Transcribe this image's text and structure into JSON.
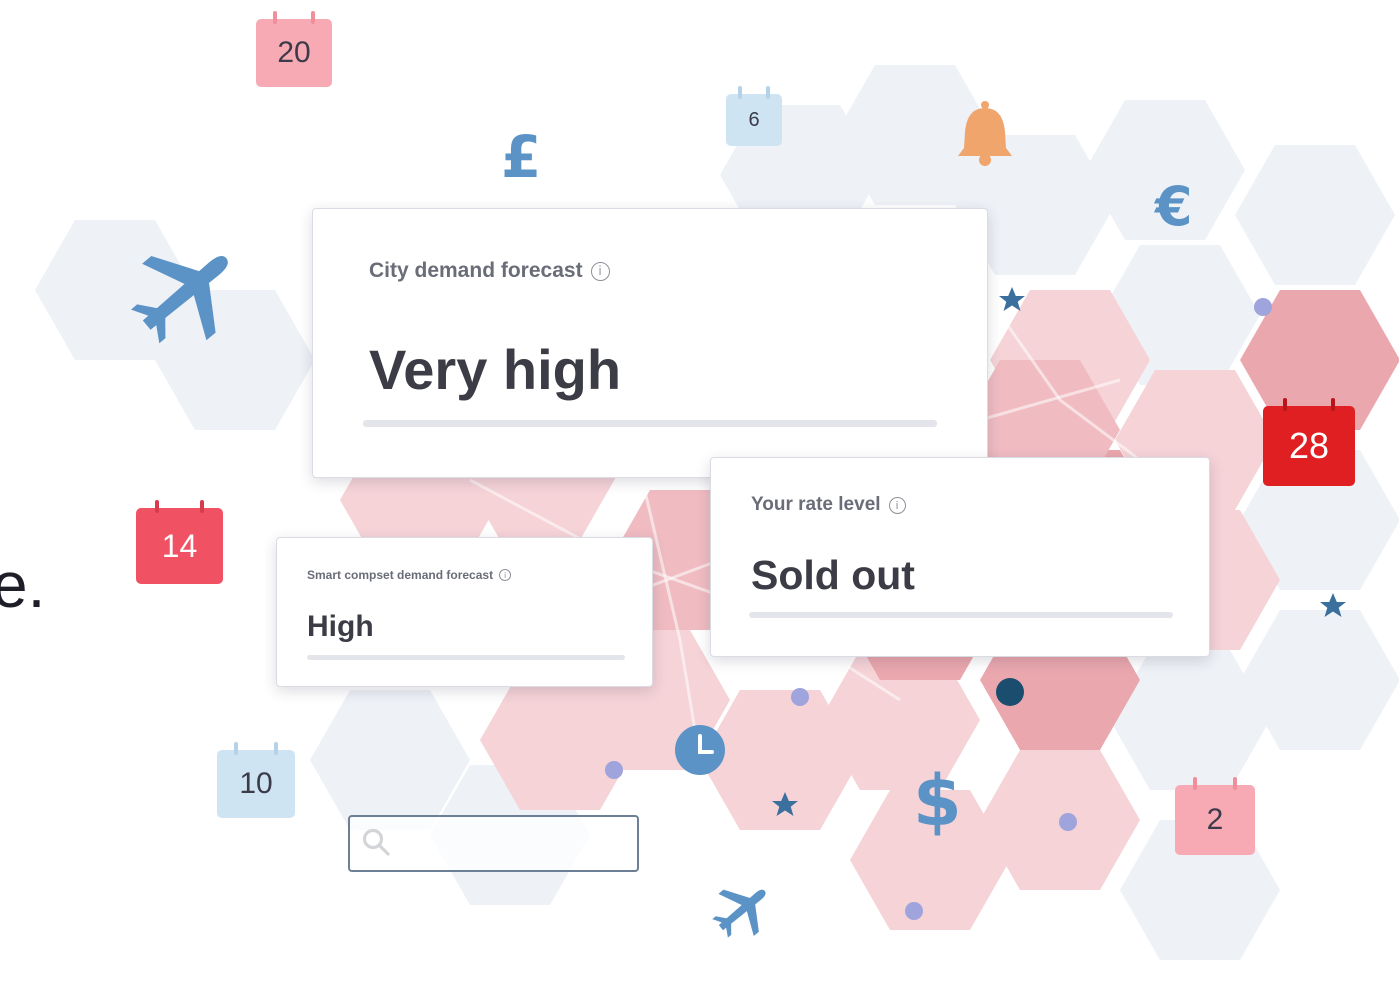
{
  "cards": {
    "city_demand": {
      "label": "City demand forecast",
      "value": "Very high"
    },
    "rate_level": {
      "label": "Your rate level",
      "value": "Sold out"
    },
    "compset_demand": {
      "label": "Smart compset demand forecast",
      "value": "High"
    }
  },
  "calendar_dates": {
    "top_left": "20",
    "top_middle": "6",
    "left": "14",
    "bottom_left": "10",
    "right": "28",
    "bottom_right": "2"
  },
  "currency_symbols": {
    "pound": "£",
    "euro": "€",
    "dollar": "$"
  },
  "edge_text": "e.",
  "search": {
    "placeholder": ""
  },
  "colors": {
    "hex_light": "#eef1f6",
    "hex_pink": "#f5cdd2",
    "hex_red": "#e9a3ab",
    "accent_blue": "#5b93c7",
    "bell_orange": "#f0a56c",
    "star_blue": "#3b6f9e",
    "dot_purple": "#a0a4dc",
    "dot_navy": "#1b4d6e",
    "calendar_pink": "#f7aab4",
    "calendar_red": "#f05263",
    "calendar_dark_red": "#e01f22",
    "calendar_blue": "#cfe4f2"
  },
  "icons": [
    "airplane-icon",
    "bell-icon",
    "clock-icon",
    "search-icon",
    "star-icon",
    "info-icon",
    "calendar-icon"
  ]
}
